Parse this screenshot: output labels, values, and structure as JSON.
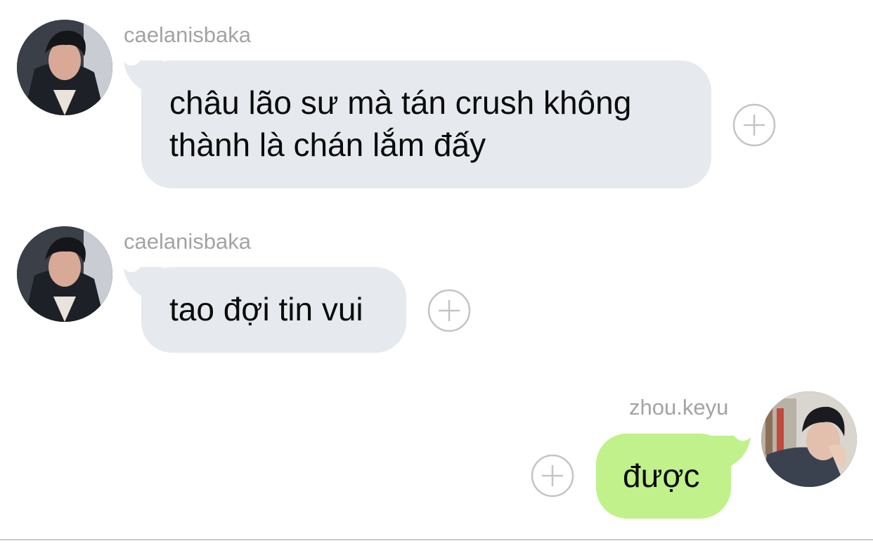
{
  "messages": [
    {
      "sender": "caelanisbaka",
      "direction": "received",
      "lines": [
        "châu lão sư mà tán crush không",
        "thành là chán lắm đấy"
      ],
      "avatar": "avatar-caelanisbaka"
    },
    {
      "sender": "caelanisbaka",
      "direction": "received",
      "lines": [
        "tao đợi tin vui"
      ],
      "avatar": "avatar-caelanisbaka"
    },
    {
      "sender": "zhou.keyu",
      "direction": "sent",
      "lines": [
        "được"
      ],
      "avatar": "avatar-zhou-keyu"
    }
  ],
  "icons": {
    "reaction_button": "plus-circle-icon"
  },
  "colors": {
    "received_bubble": "#e6e9ed",
    "sent_bubble": "#c0f18b",
    "username_text": "#a3a3a6",
    "plus_icon": "#c4c4c6"
  }
}
